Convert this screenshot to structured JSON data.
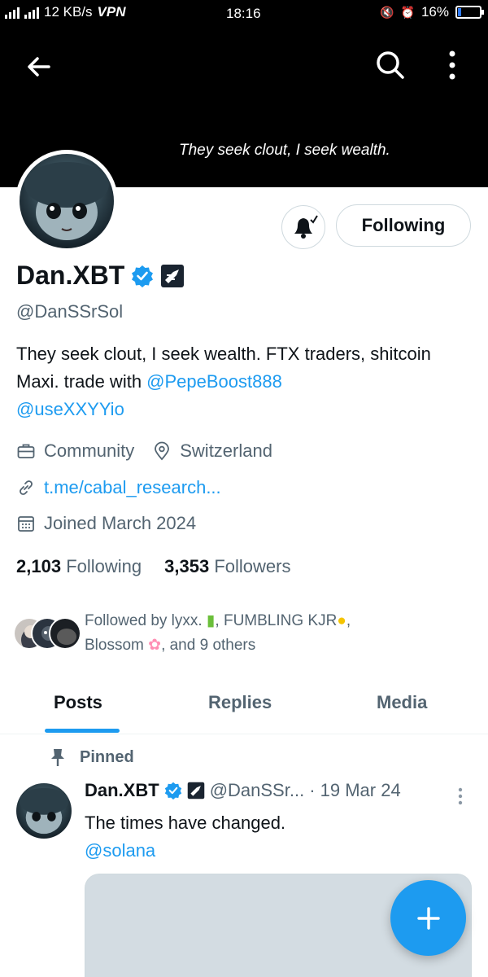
{
  "status_bar": {
    "net_speed": "12 KB/s",
    "vpn": "VPN",
    "time": "18:16",
    "battery": "16%",
    "battery_level": 0.16
  },
  "header": {
    "banner_text": "They seek clout, I seek wealth."
  },
  "actions": {
    "following_label": "Following"
  },
  "profile": {
    "display_name": "Dan.XBT",
    "handle": "@DanSSrSol",
    "bio_text": "They seek clout, I seek wealth. FTX traders, shitcoin Maxi. trade with ",
    "bio_mention_1": "@PepeBoost888",
    "bio_mention_2": "@useXXYYio",
    "category": "Community",
    "location": "Switzerland",
    "website": "t.me/cabal_research...",
    "joined": "Joined March 2024",
    "following_count": "2,103",
    "following_label": "Following",
    "followers_count": "3,353",
    "followers_label": "Followers",
    "followed_by_prefix": "Followed by lyxx. ",
    "followed_by_name2": ", FUMBLING KJR",
    "followed_by_name3": "Blossom ",
    "followed_by_suffix": ", and 9 others"
  },
  "tabs": [
    {
      "label": "Posts",
      "active": true
    },
    {
      "label": "Replies",
      "active": false
    },
    {
      "label": "Media",
      "active": false
    }
  ],
  "post": {
    "pinned_label": "Pinned",
    "author": "Dan.XBT",
    "handle": "@DanSSr...",
    "date": "· 19 Mar 24",
    "text": "The times have changed.",
    "mention": "@solana"
  },
  "colors": {
    "accent": "#1d9bf0",
    "text_primary": "#0f1419",
    "text_secondary": "#536471"
  }
}
